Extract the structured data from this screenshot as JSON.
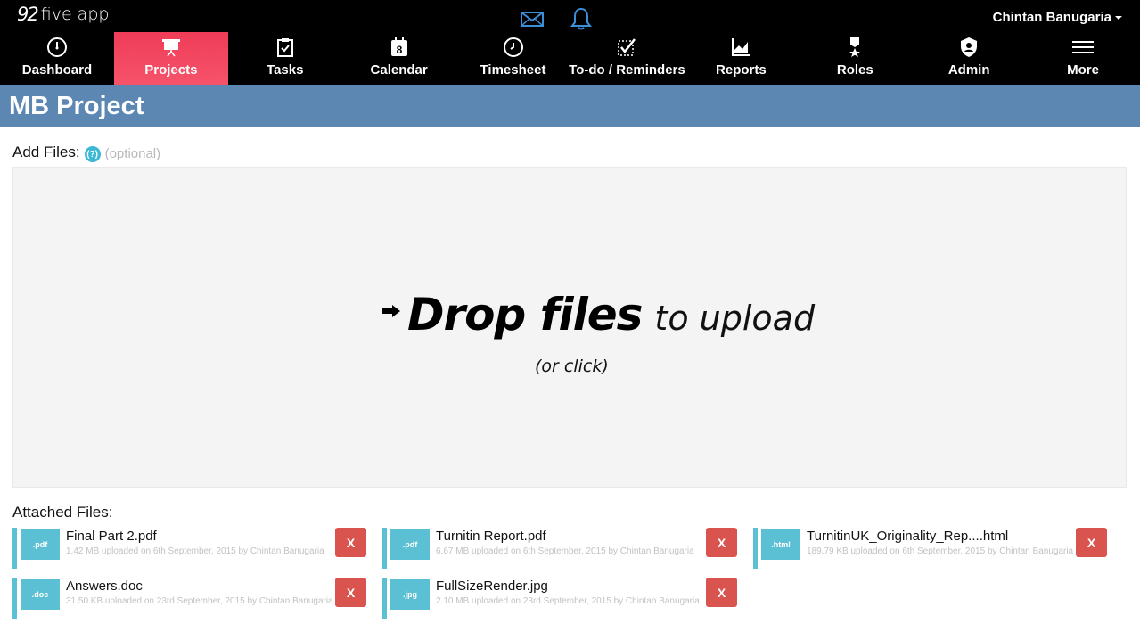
{
  "app": {
    "logo_mark": "92",
    "logo_word": "five app"
  },
  "header_icons": [
    {
      "name": "mail-icon",
      "color": "#3a8fd9"
    },
    {
      "name": "bell-icon",
      "color": "#3a8fd9"
    }
  ],
  "user": {
    "name": "Chintan Banugaria"
  },
  "nav": {
    "items": [
      {
        "label": "Dashboard",
        "icon": "speedometer-icon",
        "active": false
      },
      {
        "label": "Projects",
        "icon": "presentation-board-icon",
        "active": true
      },
      {
        "label": "Tasks",
        "icon": "clipboard-check-icon",
        "active": false
      },
      {
        "label": "Calendar",
        "icon": "calendar-icon",
        "active": false,
        "icon_text": "8"
      },
      {
        "label": "Timesheet",
        "icon": "clock-icon",
        "active": false
      },
      {
        "label": "To-do / Reminders",
        "icon": "checklist-icon",
        "active": false
      },
      {
        "label": "Reports",
        "icon": "line-chart-icon",
        "active": false
      },
      {
        "label": "Roles",
        "icon": "medal-icon",
        "active": false
      },
      {
        "label": "Admin",
        "icon": "shield-user-icon",
        "active": false
      },
      {
        "label": "More",
        "icon": "hamburger-menu-icon",
        "active": false
      }
    ],
    "active_color": "#f04a62"
  },
  "project": {
    "title": "MB Project",
    "header_color": "#5b87b2"
  },
  "add_files": {
    "label": "Add Files:",
    "help_glyph": "(?)",
    "optional": "(optional)"
  },
  "dropzone": {
    "main": "Drop files",
    "sub": "to upload",
    "hint": "(or click)"
  },
  "attached": {
    "label": "Attached Files:",
    "delete_label": "X",
    "files": [
      {
        "ext": ".pdf",
        "name": "Final Part 2.pdf",
        "meta": "1.42 MB uploaded on 6th September, 2015 by Chintan Banugaria"
      },
      {
        "ext": ".pdf",
        "name": "Turnitin Report.pdf",
        "meta": "6.67 MB uploaded on 6th September, 2015 by Chintan Banugaria"
      },
      {
        "ext": ".html",
        "name": "TurnitinUK_Originality_Rep....html",
        "meta": "189.79 KB uploaded on 6th September, 2015 by Chintan Banugaria"
      },
      {
        "ext": ".doc",
        "name": "Answers.doc",
        "meta": "31.50 KB uploaded on 23rd September, 2015 by Chintan Banugaria"
      },
      {
        "ext": ".jpg",
        "name": "FullSizeRender.jpg",
        "meta": "2.10 MB uploaded on 23rd September, 2015 by Chintan Banugaria"
      }
    ]
  }
}
